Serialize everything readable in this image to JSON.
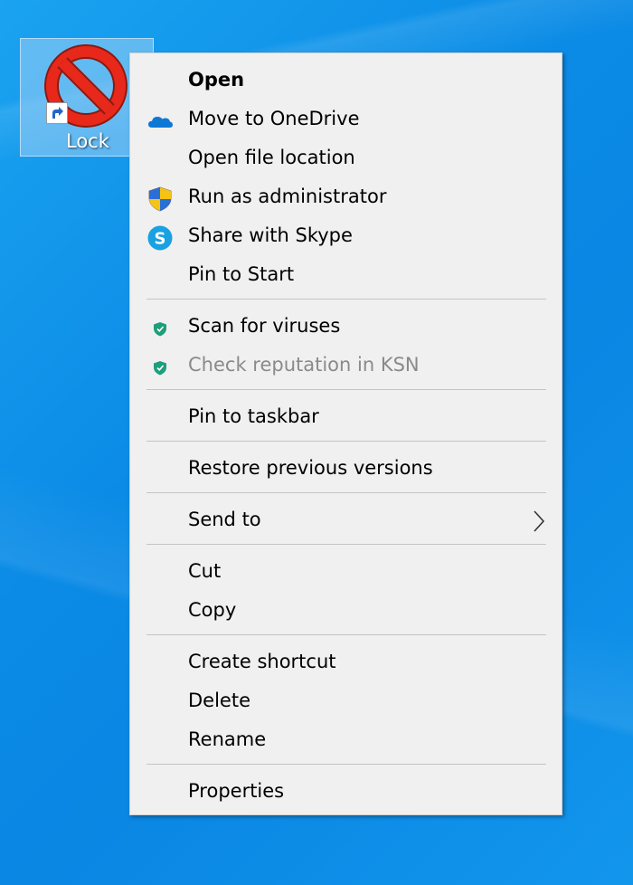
{
  "desktop": {
    "icon_label": "Lock",
    "icon": "no-entry-icon",
    "shortcut_badge": "shortcut-arrow-icon"
  },
  "menu": {
    "items": [
      {
        "label": "Open",
        "bold": true,
        "icon": ""
      },
      {
        "label": "Move to OneDrive",
        "icon": "onedrive-cloud-icon"
      },
      {
        "label": "Open file location",
        "icon": ""
      },
      {
        "label": "Run as administrator",
        "icon": "uac-shield-icon"
      },
      {
        "label": "Share with Skype",
        "icon": "skype-icon"
      },
      {
        "label": "Pin to Start",
        "icon": ""
      },
      {
        "label": "Scan for viruses",
        "icon": "kaspersky-shield-icon"
      },
      {
        "label": "Check reputation in KSN",
        "icon": "kaspersky-shield-icon",
        "disabled": true
      },
      {
        "label": "Pin to taskbar",
        "icon": ""
      },
      {
        "label": "Restore previous versions",
        "icon": ""
      },
      {
        "label": "Send to",
        "icon": "",
        "submenu": true
      },
      {
        "label": "Cut",
        "icon": ""
      },
      {
        "label": "Copy",
        "icon": ""
      },
      {
        "label": "Create shortcut",
        "icon": ""
      },
      {
        "label": "Delete",
        "icon": ""
      },
      {
        "label": "Rename",
        "icon": ""
      },
      {
        "label": "Properties",
        "icon": ""
      }
    ]
  },
  "colors": {
    "desktop_blue": "#0b8be6",
    "menu_background": "#f0f0f0",
    "disabled_text": "#8a8a8a",
    "onedrive_blue": "#0f78d4",
    "skype_blue": "#1aa1e1",
    "kaspersky_green": "#1e9e7a"
  }
}
